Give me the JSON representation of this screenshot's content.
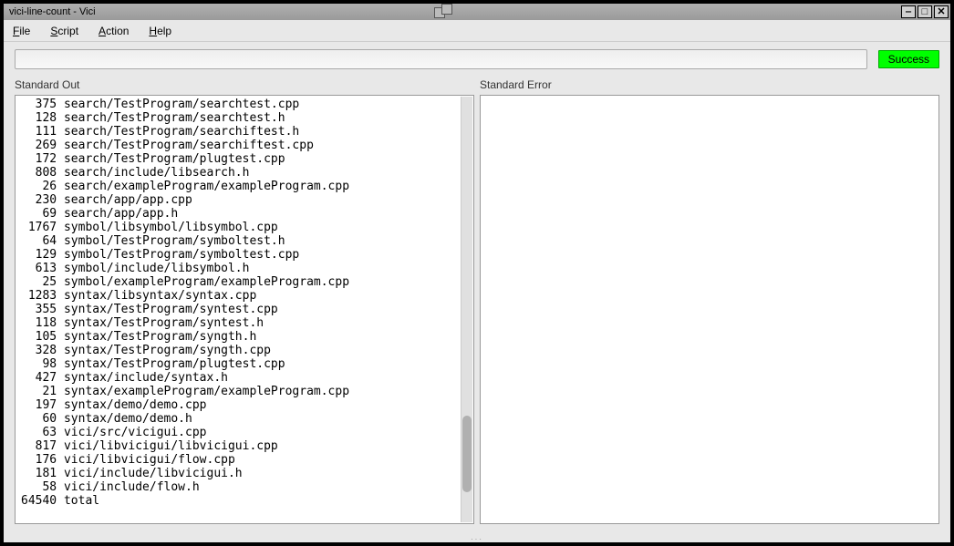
{
  "titlebar": {
    "text": "vici-line-count - Vici"
  },
  "menu": {
    "file": "File",
    "script": "Script",
    "action": "Action",
    "help": "Help"
  },
  "command": {
    "value": "",
    "placeholder": ""
  },
  "status": {
    "label": "Success"
  },
  "labels": {
    "stdout": "Standard Out",
    "stderr": "Standard Error"
  },
  "stderr": "",
  "stdout_lines": [
    {
      "count": 375,
      "path": "search/TestProgram/searchtest.cpp"
    },
    {
      "count": 128,
      "path": "search/TestProgram/searchtest.h"
    },
    {
      "count": 111,
      "path": "search/TestProgram/searchiftest.h"
    },
    {
      "count": 269,
      "path": "search/TestProgram/searchiftest.cpp"
    },
    {
      "count": 172,
      "path": "search/TestProgram/plugtest.cpp"
    },
    {
      "count": 808,
      "path": "search/include/libsearch.h"
    },
    {
      "count": 26,
      "path": "search/exampleProgram/exampleProgram.cpp"
    },
    {
      "count": 230,
      "path": "search/app/app.cpp"
    },
    {
      "count": 69,
      "path": "search/app/app.h"
    },
    {
      "count": 1767,
      "path": "symbol/libsymbol/libsymbol.cpp"
    },
    {
      "count": 64,
      "path": "symbol/TestProgram/symboltest.h"
    },
    {
      "count": 129,
      "path": "symbol/TestProgram/symboltest.cpp"
    },
    {
      "count": 613,
      "path": "symbol/include/libsymbol.h"
    },
    {
      "count": 25,
      "path": "symbol/exampleProgram/exampleProgram.cpp"
    },
    {
      "count": 1283,
      "path": "syntax/libsyntax/syntax.cpp"
    },
    {
      "count": 355,
      "path": "syntax/TestProgram/syntest.cpp"
    },
    {
      "count": 118,
      "path": "syntax/TestProgram/syntest.h"
    },
    {
      "count": 105,
      "path": "syntax/TestProgram/syngth.h"
    },
    {
      "count": 328,
      "path": "syntax/TestProgram/syngth.cpp"
    },
    {
      "count": 98,
      "path": "syntax/TestProgram/plugtest.cpp"
    },
    {
      "count": 427,
      "path": "syntax/include/syntax.h"
    },
    {
      "count": 21,
      "path": "syntax/exampleProgram/exampleProgram.cpp"
    },
    {
      "count": 197,
      "path": "syntax/demo/demo.cpp"
    },
    {
      "count": 60,
      "path": "syntax/demo/demo.h"
    },
    {
      "count": 63,
      "path": "vici/src/vicigui.cpp"
    },
    {
      "count": 817,
      "path": "vici/libvicigui/libvicigui.cpp"
    },
    {
      "count": 176,
      "path": "vici/libvicigui/flow.cpp"
    },
    {
      "count": 181,
      "path": "vici/include/libvicigui.h"
    },
    {
      "count": 58,
      "path": "vici/include/flow.h"
    },
    {
      "count": 64540,
      "path": "total"
    }
  ]
}
